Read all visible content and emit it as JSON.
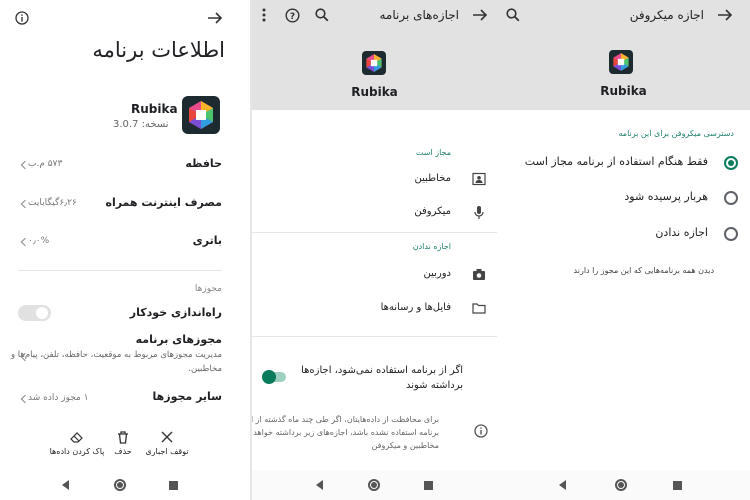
{
  "screen1": {
    "title": "اطلاعات برنامه",
    "app_name": "Rubika",
    "version_label": "نسخه: 3.0.7",
    "rows": [
      {
        "label": "حافظه",
        "value": "۵۷۳ م.ب"
      },
      {
        "label": "مصرف اینترنت همراه",
        "value": "۶٫۲۶گیگابایت"
      },
      {
        "label": "باتری",
        "value": "۰٫۰%"
      }
    ],
    "permissions_section": "مجوزها",
    "autostart_label": "راه‌اندازی خودکار",
    "app_permissions_title": "مجوزهای برنامه",
    "app_permissions_desc_1": "مدیریت مجوزهای مربوط به موقعیت، حافظه، تلفن، پیام‌ها و",
    "app_permissions_desc_2": "مخاطبین.",
    "other_permissions_label": "سایر مجوزها",
    "other_permissions_value": "۱ مجوز داده شد",
    "actions": {
      "force_stop": "توقف اجباری",
      "delete": "حذف",
      "clear_data": "پاک کردن داده‌ها"
    }
  },
  "screen2": {
    "title": "اجازه‌های برنامه",
    "app_name": "Rubika",
    "allowed_header": "مجاز است",
    "allowed_items": [
      "مخاطبین",
      "میکروفن"
    ],
    "denied_header": "اجازه ندادن",
    "denied_items": [
      "دوربین",
      "فایل‌ها و رسانه‌ها"
    ],
    "auto_remove_line1": "اگر از برنامه استفاده نمی‌شود، اجازه‌ها",
    "auto_remove_line2": "برداشته شوند",
    "info_line1": "برای محافظت از داده‌هایتان، اگر طی چند ماه گذشته از این",
    "info_line2": "برنامه استفاده نشده باشد، اجازه‌های زیر برداشته خواهد شد:",
    "info_line3": "مخاطبین و میکروفن"
  },
  "screen3": {
    "title": "اجازه میکروفن",
    "app_name": "Rubika",
    "section_label": "دسترسی میکروفن برای این برنامه",
    "options": [
      "فقط هنگام استفاده از برنامه مجاز است",
      "هربار پرسیده شود",
      "اجازه ندادن"
    ],
    "selected_option": 0,
    "see_all": "دیدن همه برنامه‌هایی که این مجوز را دارند"
  },
  "colors": {
    "accent_green": "#0a7c5c",
    "header_gray": "#e2e2e2",
    "section_teal": "#1f7f6d"
  }
}
